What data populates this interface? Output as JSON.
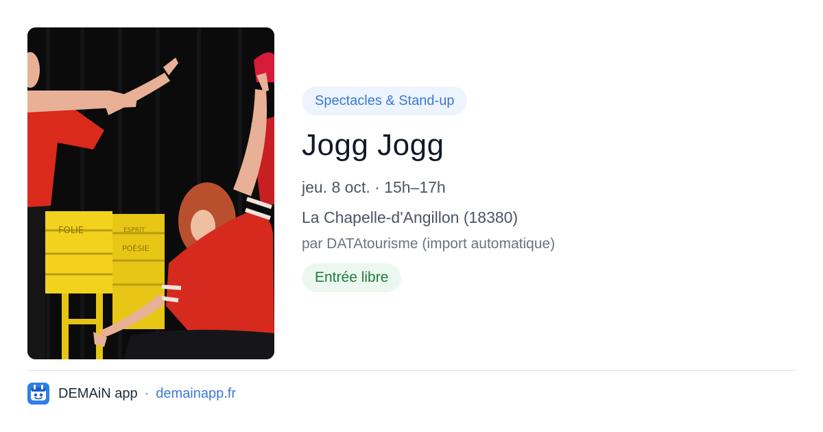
{
  "event": {
    "category": "Spectacles & Stand-up",
    "title": "Jogg Jogg",
    "datetime": "jeu. 8 oct. · 15h–17h",
    "location": "La Chapelle-d'Angillon (18380)",
    "source": "par DATAtourisme (import automatique)",
    "price": "Entrée libre"
  },
  "photo": {
    "alt": "",
    "props_text": [
      "FOLIE",
      "ESPRIT",
      "POÉSIE"
    ]
  },
  "footer": {
    "app_name": "DEMAiN app",
    "separator": "·",
    "site": "demainapp.fr",
    "logo_icon": "app-logo-icon"
  },
  "colors": {
    "category_bg": "#eef4fd",
    "category_text": "#3a78d6",
    "price_bg": "#ecf8ef",
    "price_text": "#1f7a3a",
    "title_text": "#111827",
    "link": "#3a78d6"
  }
}
